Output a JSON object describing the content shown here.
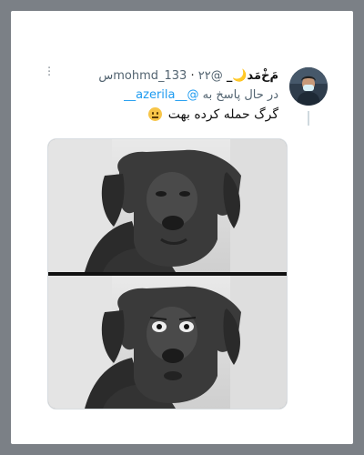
{
  "tweet": {
    "display_name": "مَ‌خ‌ْمَد🌙_",
    "handle": "@mohmd_133",
    "time": "۲۲س",
    "separator": "·",
    "reply_prefix": "در حال پاسخ به",
    "reply_mention": "@__azerila__",
    "text": "گرگ حمله کرده بهت",
    "emoji_icon": "neutral-face-emoji"
  },
  "media": {
    "panels": [
      "dog-meme-panel-top",
      "dog-meme-panel-bottom"
    ]
  },
  "colors": {
    "background": "#7b8086",
    "card": "#ffffff",
    "mention": "#1d9bf0",
    "secondary_text": "#536471"
  }
}
